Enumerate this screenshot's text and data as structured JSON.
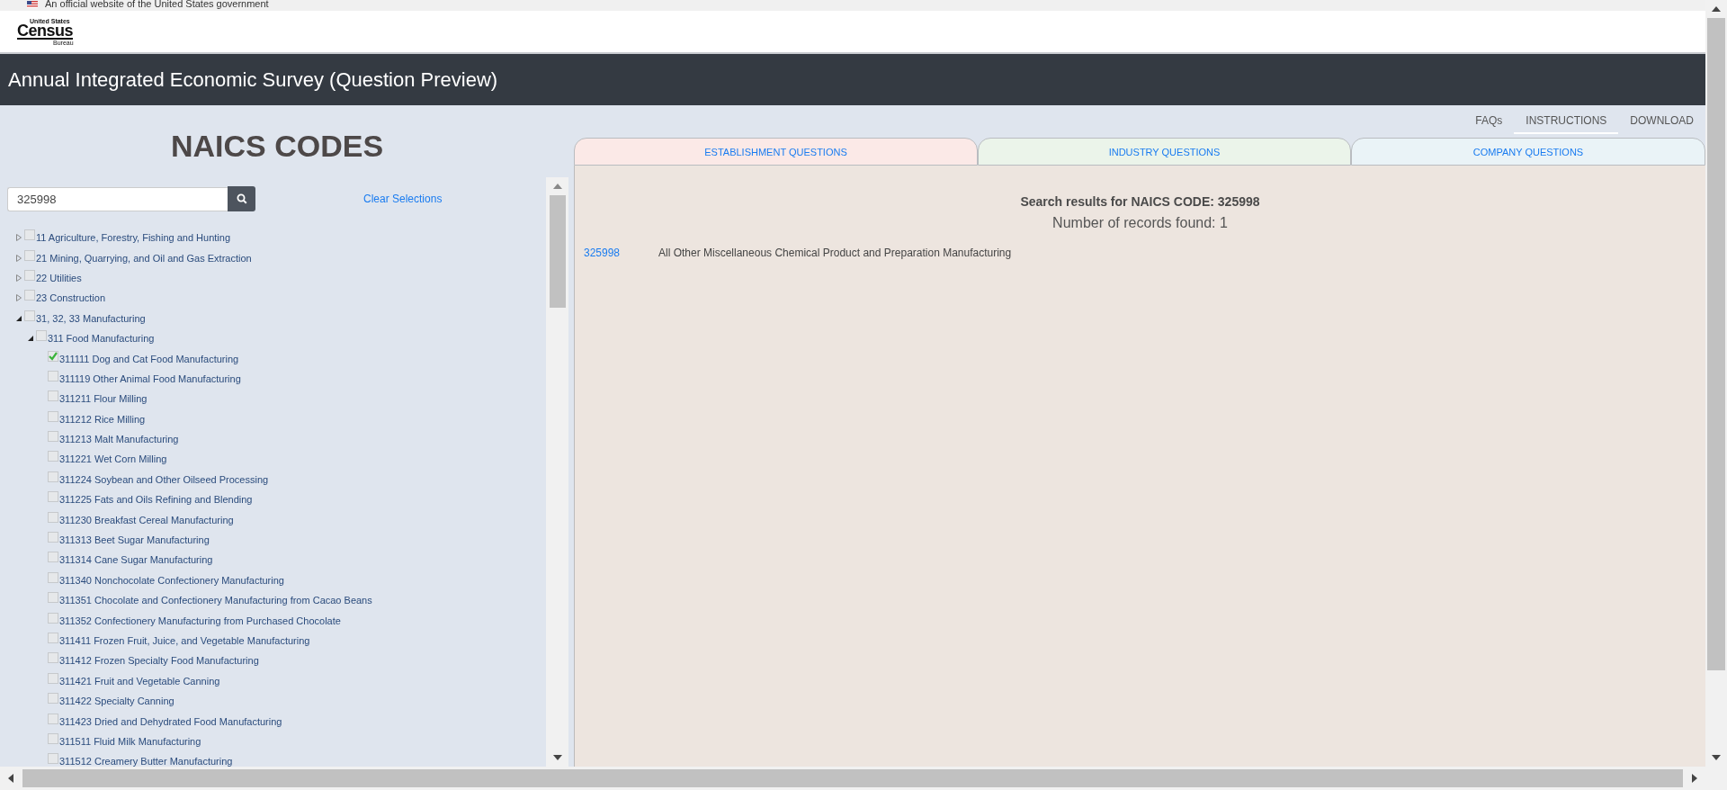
{
  "gov_banner": {
    "text": "An official website of the United States government"
  },
  "logo": {
    "top": "United States",
    "main": "Census",
    "bottom": "Bureau"
  },
  "header": {
    "title": "Annual Integrated Economic Survey (Question Preview)"
  },
  "sidebar": {
    "heading": "NAICS CODES",
    "search": {
      "value": "325998"
    },
    "clear_link": "Clear Selections",
    "tree": [
      {
        "label": "11 Agriculture, Forestry, Fishing and Hunting",
        "checked": false,
        "expanded": false
      },
      {
        "label": "21 Mining, Quarrying, and Oil and Gas Extraction",
        "checked": false,
        "expanded": false
      },
      {
        "label": "22 Utilities",
        "checked": false,
        "expanded": false
      },
      {
        "label": "23 Construction",
        "checked": false,
        "expanded": false
      },
      {
        "label": "31, 32, 33 Manufacturing",
        "checked": false,
        "expanded": true,
        "children": [
          {
            "label": "311 Food Manufacturing",
            "checked": false,
            "expanded": true,
            "children": [
              {
                "label": "311111 Dog and Cat Food Manufacturing",
                "checked": true
              },
              {
                "label": "311119 Other Animal Food Manufacturing",
                "checked": false
              },
              {
                "label": "311211 Flour Milling",
                "checked": false
              },
              {
                "label": "311212 Rice Milling",
                "checked": false
              },
              {
                "label": "311213 Malt Manufacturing",
                "checked": false
              },
              {
                "label": "311221 Wet Corn Milling",
                "checked": false
              },
              {
                "label": "311224 Soybean and Other Oilseed Processing",
                "checked": false
              },
              {
                "label": "311225 Fats and Oils Refining and Blending",
                "checked": false
              },
              {
                "label": "311230 Breakfast Cereal Manufacturing",
                "checked": false
              },
              {
                "label": "311313 Beet Sugar Manufacturing",
                "checked": false
              },
              {
                "label": "311314 Cane Sugar Manufacturing",
                "checked": false
              },
              {
                "label": "311340 Nonchocolate Confectionery Manufacturing",
                "checked": false
              },
              {
                "label": "311351 Chocolate and Confectionery Manufacturing from Cacao Beans",
                "checked": false
              },
              {
                "label": "311352 Confectionery Manufacturing from Purchased Chocolate",
                "checked": false
              },
              {
                "label": "311411 Frozen Fruit, Juice, and Vegetable Manufacturing",
                "checked": false
              },
              {
                "label": "311412 Frozen Specialty Food Manufacturing",
                "checked": false
              },
              {
                "label": "311421 Fruit and Vegetable Canning",
                "checked": false
              },
              {
                "label": "311422 Specialty Canning",
                "checked": false
              },
              {
                "label": "311423 Dried and Dehydrated Food Manufacturing",
                "checked": false
              },
              {
                "label": "311511 Fluid Milk Manufacturing",
                "checked": false
              },
              {
                "label": "311512 Creamery Butter Manufacturing",
                "checked": false
              }
            ]
          }
        ]
      }
    ]
  },
  "toolbar": [
    {
      "label": "FAQs",
      "selected": false
    },
    {
      "label": "INSTRUCTIONS",
      "selected": true
    },
    {
      "label": "DOWNLOAD",
      "selected": false
    }
  ],
  "tabs": [
    {
      "label": "ESTABLISHMENT QUESTIONS",
      "color": "#fbe9e7"
    },
    {
      "label": "INDUSTRY QUESTIONS",
      "color": "#ebf4ea"
    },
    {
      "label": "COMPANY QUESTIONS",
      "color": "#eaf3f7"
    }
  ],
  "results": {
    "heading": "Search results for NAICS CODE: 325998",
    "count": "Number of records found: 1",
    "rows": [
      {
        "code": "325998",
        "description": "All Other Miscellaneous Chemical Product and Preparation Manufacturing"
      }
    ]
  }
}
